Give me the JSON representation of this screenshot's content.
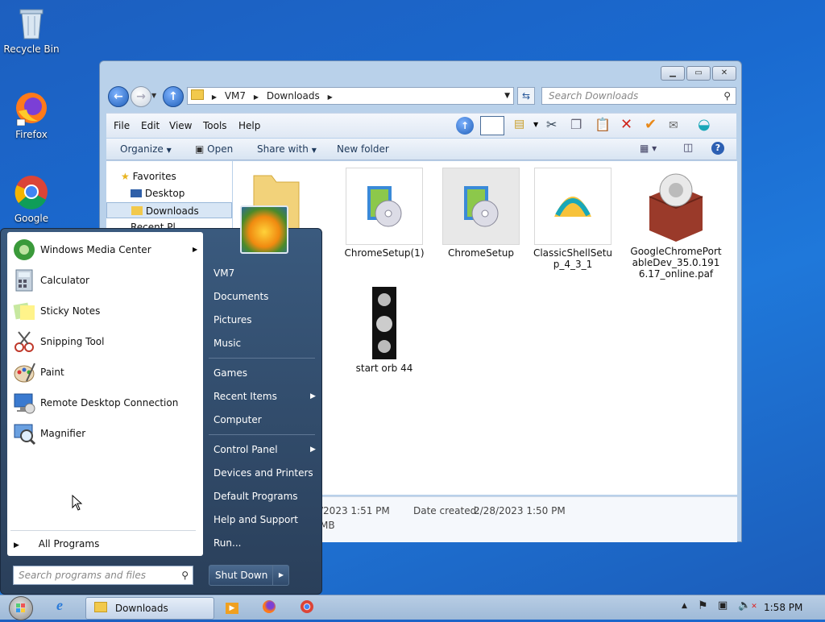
{
  "desktop": {
    "icons": [
      {
        "label": "Recycle Bin",
        "icon": "recycle-bin-icon"
      },
      {
        "label": "Firefox",
        "icon": "firefox-icon"
      },
      {
        "label": "Google",
        "icon": "chrome-icon"
      }
    ]
  },
  "explorer": {
    "address_parts": [
      "VM7",
      "Downloads"
    ],
    "search_placeholder": "Search Downloads",
    "menu": [
      "File",
      "Edit",
      "View",
      "Tools",
      "Help"
    ],
    "commands": [
      "Organize",
      "Open",
      "Share with",
      "New folder"
    ],
    "nav": {
      "favorites": "Favorites",
      "items": [
        "Desktop",
        "Downloads",
        "Recent Pl..."
      ]
    },
    "files": [
      {
        "name": "ChromeSetup(1)",
        "icon": "installer-icon"
      },
      {
        "name": "ChromeSetup",
        "icon": "installer-icon"
      },
      {
        "name": "ClassicShellSetup_4_3_1",
        "icon": "shell-icon"
      },
      {
        "name": "GoogleChromePortableDev_35.0.1916.17_online.paf",
        "icon": "package-box-icon"
      },
      {
        "name": "start orb 44",
        "icon": "start-orb-image-icon"
      }
    ],
    "details": {
      "date_modified_partial": "/2023 1:51 PM",
      "date_created_label": "Date created:",
      "date_created": "2/28/2023 1:50 PM",
      "size_partial": "MB"
    }
  },
  "start_menu": {
    "programs": [
      {
        "label": "Windows Media Center",
        "has_arrow": true,
        "icon": "media-center-icon"
      },
      {
        "label": "Calculator",
        "icon": "calculator-icon"
      },
      {
        "label": "Sticky Notes",
        "icon": "sticky-notes-icon"
      },
      {
        "label": "Snipping Tool",
        "icon": "snipping-tool-icon"
      },
      {
        "label": "Paint",
        "icon": "paint-icon"
      },
      {
        "label": "Remote Desktop Connection",
        "icon": "remote-desktop-icon"
      },
      {
        "label": "Magnifier",
        "icon": "magnifier-icon"
      }
    ],
    "all_programs": "All Programs",
    "search_placeholder": "Search programs and files",
    "right": [
      "VM7",
      "Documents",
      "Pictures",
      "Music",
      "Games",
      "Recent Items",
      "Computer",
      "Control Panel",
      "Devices and Printers",
      "Default Programs",
      "Help and Support",
      "Run..."
    ],
    "shutdown": "Shut Down"
  },
  "taskbar": {
    "downloads_label": "Downloads",
    "clock": "1:58 PM"
  },
  "colors": {
    "desktop": "#1a6ad0",
    "start_menu_bg": "#2f4a6b",
    "window_frame": "#b9d1ea"
  }
}
